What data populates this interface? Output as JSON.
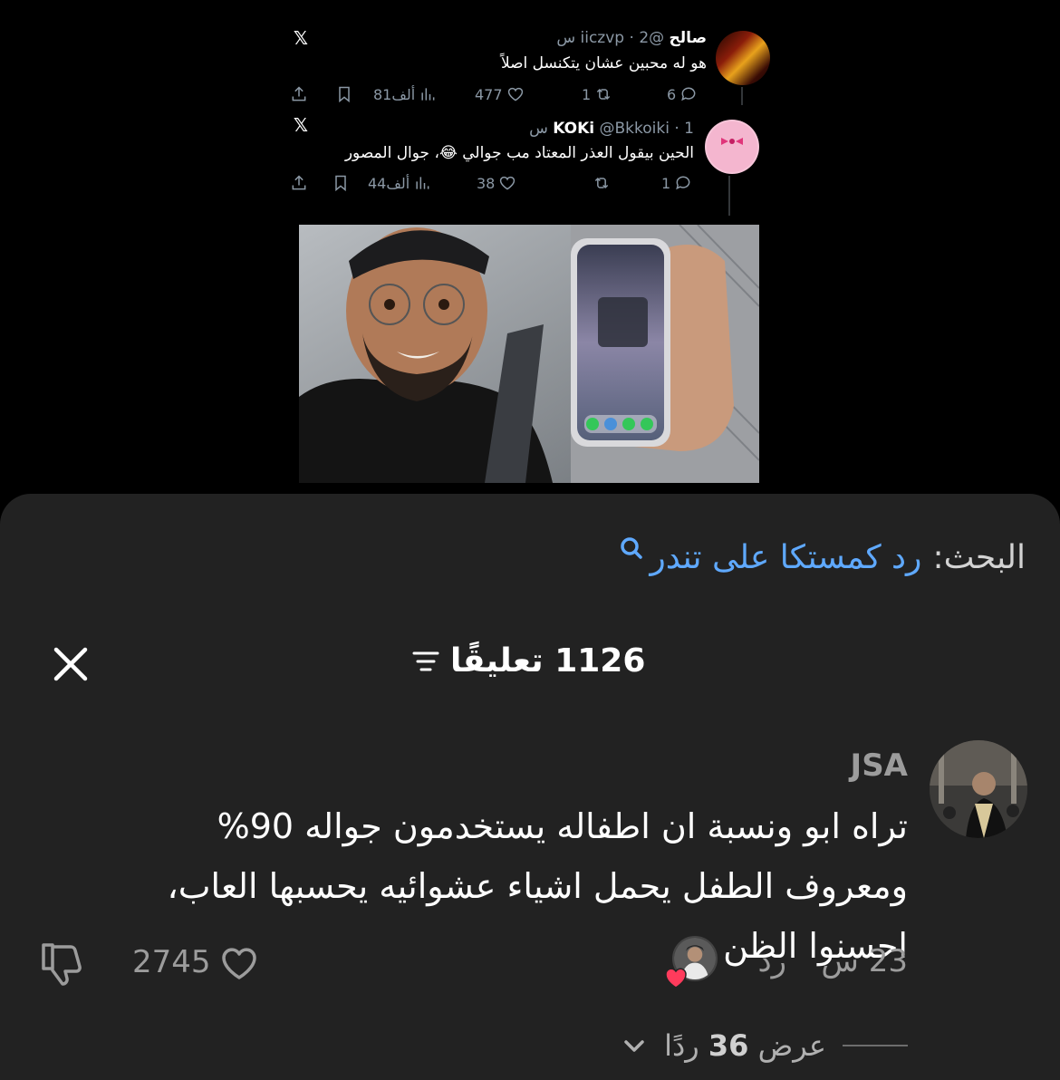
{
  "tweets": [
    {
      "name": "صالح",
      "handle": "@iiczvp",
      "time": "2 س",
      "text": "هو له محبين عشان يتكنسل اصلاً",
      "replies": "6",
      "retweets": "1",
      "likes": "477",
      "views": "81ألف"
    },
    {
      "name": "KOKi",
      "handle": "@Bkkoiki",
      "time": "1 س",
      "text": "الحين بيقول العذر المعتاد مب جوالي 😂، جوال المصور",
      "replies": "1",
      "retweets": "",
      "likes": "38",
      "views": "44ألف"
    }
  ],
  "search": {
    "label": "البحث:",
    "query": "رد كمستكا على تندر"
  },
  "comments_header": {
    "count_text": "1126 تعليقًا"
  },
  "comment": {
    "username": "JSA",
    "text": "تراه ابو ونسبة ان اطفاله يستخدمون جواله 90% ومعروف الطفل يحمل اشياء عشوائيه يحسبها العاب، احسنوا الظن",
    "time": "23 س",
    "reply_label": "رد",
    "likes": "2745",
    "view_replies_prefix": "عرض",
    "view_replies_count": "36",
    "view_replies_suffix": "ردًا"
  },
  "icons": {
    "search": "search-icon",
    "close": "close-icon",
    "filter": "filter-icon",
    "like": "heart-icon",
    "dislike": "thumbs-down-icon",
    "chevron": "chevron-down-icon",
    "x_logo": "x-logo-icon"
  },
  "colors": {
    "sheet_bg": "#222222",
    "search_query": "#5fa9ff",
    "creator_heart": "#ff3b5c"
  }
}
